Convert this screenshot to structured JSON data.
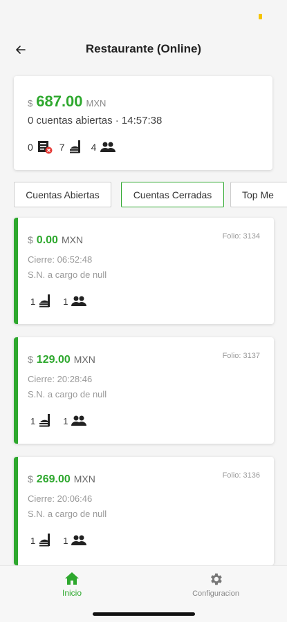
{
  "header": {
    "title": "Restaurante (Online)"
  },
  "summary": {
    "currency_symbol": "$",
    "amount": "687.00",
    "currency_code": "MXN",
    "subtitle": "0 cuentas abiertas · 14:57:38",
    "stats": {
      "bills": "0",
      "dishes": "7",
      "people": "4"
    }
  },
  "tabs": [
    {
      "label": "Cuentas Abiertas"
    },
    {
      "label": "Cuentas Cerradas"
    },
    {
      "label": "Top Me"
    }
  ],
  "accounts": [
    {
      "currency_symbol": "$",
      "amount": "0.00",
      "currency_code": "MXN",
      "folio": "Folio: 3134",
      "cierre": "Cierre: 06:52:48",
      "cargo": "S.N. a cargo de null",
      "dishes": "1",
      "people": "1"
    },
    {
      "currency_symbol": "$",
      "amount": "129.00",
      "currency_code": "MXN",
      "folio": "Folio: 3137",
      "cierre": "Cierre: 20:28:46",
      "cargo": "S.N. a cargo de null",
      "dishes": "1",
      "people": "1"
    },
    {
      "currency_symbol": "$",
      "amount": "269.00",
      "currency_code": "MXN",
      "folio": "Folio: 3136",
      "cierre": "Cierre: 20:06:46",
      "cargo": "S.N. a cargo de null",
      "dishes": "1",
      "people": "1"
    }
  ],
  "nav": {
    "home_label": "Inicio",
    "config_label": "Configuracion"
  },
  "colors": {
    "accent": "#2ea82e",
    "status": "#f5c400",
    "error": "#e53935"
  },
  "icons": {
    "back": "arrow-left-icon",
    "bill": "receipt-cancel-icon",
    "dish": "room-service-icon",
    "people": "people-icon",
    "home": "home-icon",
    "settings": "gear-icon"
  }
}
